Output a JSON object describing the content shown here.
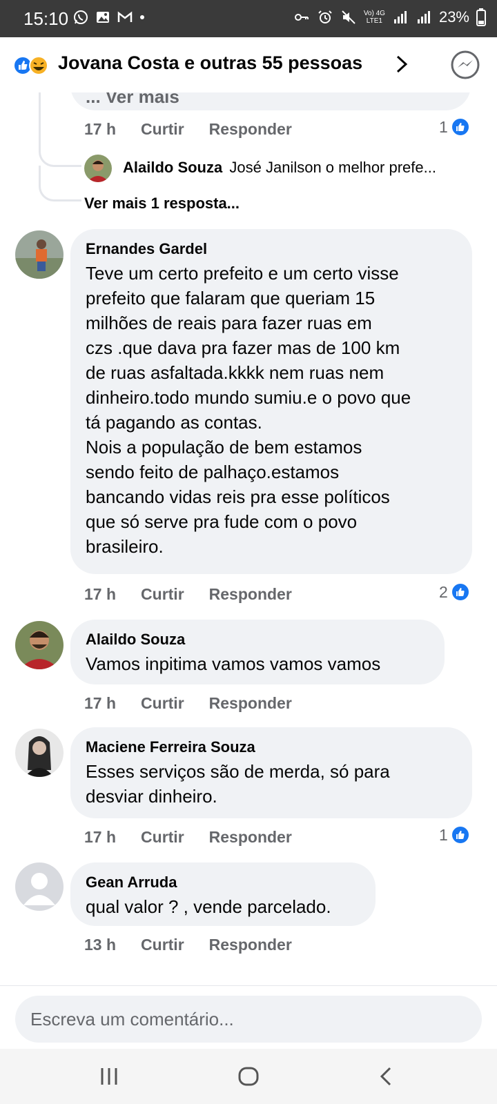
{
  "status_bar": {
    "time": "15:10",
    "battery": "23%",
    "network_top": "Vo) 4G",
    "network_bottom": "LTE1"
  },
  "header": {
    "title": "Jovana Costa e outras 55 pessoas"
  },
  "thread_top": {
    "clipped_text": "... Ver mais",
    "time": "17 h",
    "like_label": "Curtir",
    "reply_label": "Responder",
    "likes": "1",
    "reply_author": "Alaildo Souza",
    "reply_preview": "José Janilson o melhor prefe...",
    "more_replies": "Ver mais 1 resposta..."
  },
  "comments": [
    {
      "author": "Ernandes Gardel",
      "text": "Teve um certo prefeito e um certo visse\nprefeito que falaram que queriam 15\nmilhões de reais para fazer ruas em\nczs .que dava pra fazer mas de 100 km\nde ruas asfaltada.kkkk nem ruas nem\ndinheiro.todo mundo sumiu.e o povo que\ntá pagando as contas.\nNois a população de bem estamos\nsendo feito de palhaço.estamos\nbancando vidas reis pra esse políticos\nque só serve pra fude com o povo\nbrasileiro.",
      "time": "17 h",
      "like_label": "Curtir",
      "reply_label": "Responder",
      "likes": "2"
    },
    {
      "author": "Alaildo Souza",
      "text": "Vamos inpitima vamos vamos vamos",
      "time": "17 h",
      "like_label": "Curtir",
      "reply_label": "Responder",
      "likes": ""
    },
    {
      "author": "Maciene Ferreira Souza",
      "text": "Esses serviços são de merda, só para\ndesviar dinheiro.",
      "time": "17 h",
      "like_label": "Curtir",
      "reply_label": "Responder",
      "likes": "1"
    },
    {
      "author": "Gean Arruda",
      "text": "qual valor ? , vende parcelado.",
      "time": "13 h",
      "like_label": "Curtir",
      "reply_label": "Responder",
      "likes": ""
    }
  ],
  "composer": {
    "placeholder": "Escreva um comentário..."
  },
  "colors": {
    "brand_blue": "#1877f2",
    "bubble_bg": "#f0f2f5",
    "meta_gray": "#65676b"
  }
}
